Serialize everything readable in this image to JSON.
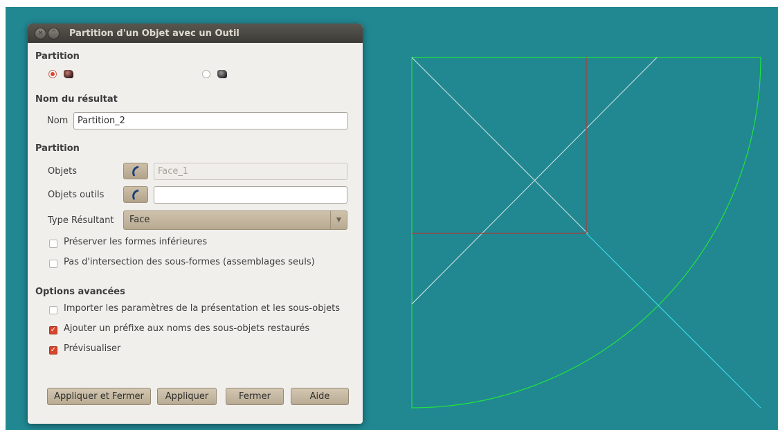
{
  "dialog": {
    "title": "Partition d'un Objet avec un Outil",
    "partition_header": "Partition",
    "result_name_header": "Nom du résultat",
    "name_label": "Nom",
    "name_value": "Partition_2",
    "partition_section_header": "Partition",
    "objects_label": "Objets",
    "objects_value": "Face_1",
    "tool_objects_label": "Objets outils",
    "tool_objects_value": "",
    "result_type_label": "Type Résultant",
    "result_type_value": "Face",
    "keep_subshapes_label": "Préserver les formes inférieures",
    "no_self_intersection_label": "Pas d'intersection des sous-formes (assemblages seuls)",
    "advanced_header": "Options avancées",
    "import_params_label": "Importer les paramètres de la présentation et les sous-objets",
    "add_prefix_label": "Ajouter un préfixe aux noms des sous-objets restaurés",
    "preview_label": "Prévisualiser",
    "checks": {
      "keep_subshapes": false,
      "no_self_intersection": false,
      "import_params": false,
      "add_prefix": true,
      "preview": true
    },
    "buttons": {
      "apply_close": "Appliquer et Fermer",
      "apply": "Appliquer",
      "close": "Fermer",
      "help": "Aide"
    }
  },
  "colors": {
    "viewport_background": "#218892",
    "face_outline": "#22e23c",
    "diagonal_lines": "#d8e6e6",
    "inner_square": "#b03a3a",
    "preview_diagonal": "#36d6e3"
  }
}
